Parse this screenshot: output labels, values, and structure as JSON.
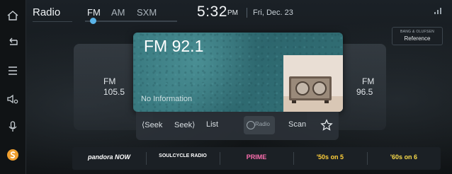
{
  "header": {
    "title": "Radio",
    "bands": [
      "FM",
      "AM",
      "SXM"
    ],
    "time": "5:32",
    "ampm": "PM",
    "date": "Fri, Dec. 23"
  },
  "sound": {
    "brand": "BANG & OLUFSEN",
    "mode": "Reference"
  },
  "station": {
    "frequency": "FM 92.1",
    "rds": "No Information"
  },
  "prev_station": {
    "band": "FM",
    "frequency": "105.5"
  },
  "next_station": {
    "band": "FM",
    "frequency": "96.5"
  },
  "controls": {
    "seek_back": "⟨Seek",
    "seek_forward": "Seek⟩",
    "list": "List",
    "hd": "Radio",
    "scan": "Scan"
  },
  "presets": [
    "pandora NOW",
    "SOULCYCLE RADIO",
    "PRIME",
    "'50s on 5",
    "'60s on 6"
  ],
  "colors": {
    "accent": "#5ab4e8",
    "orange": "#f0a030",
    "card_teal": "#3e8187"
  }
}
